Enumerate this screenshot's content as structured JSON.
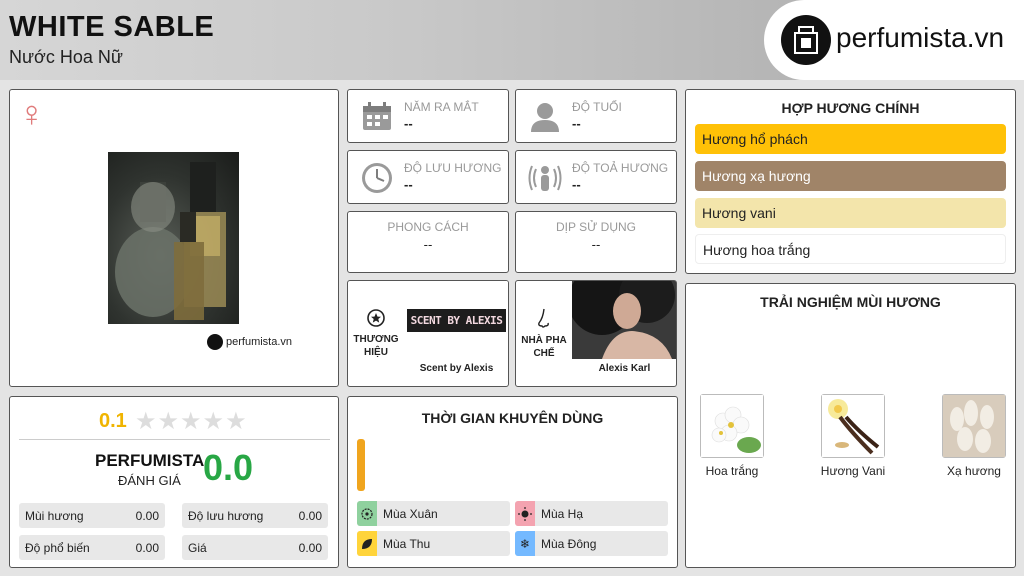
{
  "header": {
    "title": "WHITE SABLE",
    "subtitle": "Nước Hoa Nữ",
    "logo_text": "perfumista.vn"
  },
  "image_card": {
    "gender_symbol": "♀",
    "watermark": "perfumista.vn"
  },
  "info": {
    "release_year": {
      "label": "NĂM RA MẮT",
      "value": "--"
    },
    "age": {
      "label": "ĐỘ TUỔI",
      "value": "--"
    },
    "longevity": {
      "label": "ĐỘ LƯU HƯƠNG",
      "value": "--"
    },
    "sillage": {
      "label": "ĐỘ TOẢ HƯƠNG",
      "value": "--"
    },
    "style": {
      "label": "PHONG CÁCH",
      "value": "--"
    },
    "occasion": {
      "label": "DỊP SỬ DỤNG",
      "value": "--"
    },
    "brand": {
      "label_line1": "THƯƠNG",
      "label_line2": "HIỆU",
      "logo_text": "SCENT BY ALEXIS",
      "name": "Scent by Alexis"
    },
    "perfumer": {
      "label_line1": "NHÀ PHA",
      "label_line2": "CHẾ",
      "name": "Alexis Karl"
    }
  },
  "accords": {
    "title": "HỢP HƯƠNG CHÍNH",
    "items": [
      {
        "label": "Hương hổ phách",
        "color": "#ffc107",
        "text_color": "#222222"
      },
      {
        "label": "Hương xạ hương",
        "color": "#a08468",
        "text_color": "#ffffff"
      },
      {
        "label": "Hương vani",
        "color": "#f3e5ab",
        "text_color": "#222222"
      },
      {
        "label": "Hương hoa trắng",
        "color": "#ffffff",
        "text_color": "#222222"
      }
    ]
  },
  "experience": {
    "title": "TRẢI NGHIỆM MÙI HƯƠNG",
    "notes": [
      {
        "label": "Hoa trắng"
      },
      {
        "label": "Hương Vani"
      },
      {
        "label": "Xạ hương"
      }
    ]
  },
  "rating": {
    "user_score": "0.1",
    "stars": "★★★★★",
    "brand_label": "PERFUMISTA",
    "brand_sub": "ĐÁNH GIÁ",
    "big_score": "0.0",
    "scores": [
      {
        "label": "Mùi hương",
        "value": "0.00"
      },
      {
        "label": "Độ lưu hương",
        "value": "0.00"
      },
      {
        "label": "Độ phổ biến",
        "value": "0.00"
      },
      {
        "label": "Giá",
        "value": "0.00"
      }
    ]
  },
  "time": {
    "title": "THỜI GIAN KHUYÊN DÙNG",
    "seasons": [
      {
        "label": "Mùa Xuân",
        "color": "#8fd19e"
      },
      {
        "label": "Mùa Hạ",
        "color": "#f4a3b0"
      },
      {
        "label": "Mùa Thu",
        "color": "#ffd43b"
      },
      {
        "label": "Mùa Đông",
        "color": "#74b9ff"
      }
    ]
  }
}
